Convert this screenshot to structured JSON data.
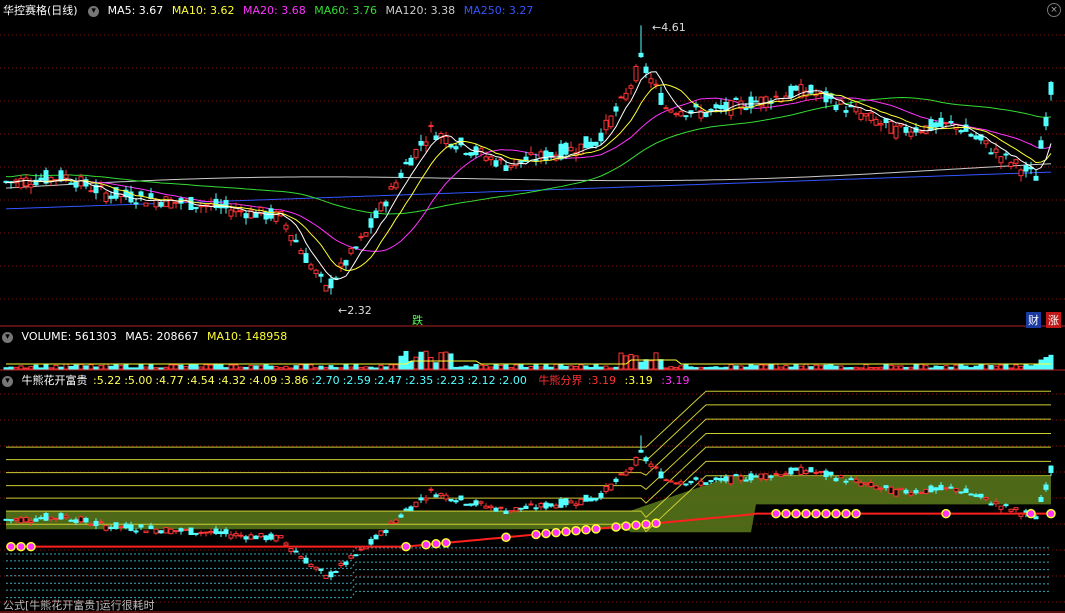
{
  "window": {
    "title": "华控赛格(日线)"
  },
  "main_panel": {
    "ma": [
      {
        "label": "MA5: 3.67",
        "color": "#ffffff"
      },
      {
        "label": "MA10: 3.62",
        "color": "#ffff33"
      },
      {
        "label": "MA20: 3.68",
        "color": "#ff33ff"
      },
      {
        "label": "MA60: 3.76",
        "color": "#33dd33"
      },
      {
        "label": "MA120: 3.38",
        "color": "#cccccc"
      },
      {
        "label": "MA250: 3.27",
        "color": "#3355ff"
      }
    ],
    "high_label": "4.61",
    "low_label": "2.32",
    "tag_die": "跌",
    "tag_cai": "财",
    "tag_zhang": "涨"
  },
  "volume_panel": {
    "label": "VOLUME: 561303",
    "ma5": "MA5: 208667",
    "ma10": "MA10: 148958"
  },
  "indicator_panel": {
    "name": "牛熊花开富贵",
    "levels": [
      ":5.22",
      ":5.00",
      ":4.77",
      ":4.54",
      ":4.32",
      ":4.09",
      ":3.86",
      ":2.70",
      ":2.59",
      ":2.47",
      ":2.35",
      ":2.23",
      ":2.12",
      ":2.00"
    ],
    "boundary_label": "牛熊分界",
    "boundary_values": [
      ":3.19",
      ":3.19",
      ":3.19"
    ],
    "footer": "公式[牛熊花开富贵]运行很耗时"
  },
  "colors": {
    "up": "#ff3333",
    "down": "#54ffff",
    "grid": "#7a1212",
    "band": "#5a7a1a"
  },
  "chart_data": {
    "type": "candlestick",
    "high": 4.61,
    "low": 2.32,
    "ma_values": {
      "MA5": 3.67,
      "MA10": 3.62,
      "MA20": 3.68,
      "MA60": 3.76,
      "MA120": 3.38,
      "MA250": 3.27
    },
    "volume": 561303,
    "volume_ma": {
      "MA5": 208667,
      "MA10": 148958
    }
  }
}
